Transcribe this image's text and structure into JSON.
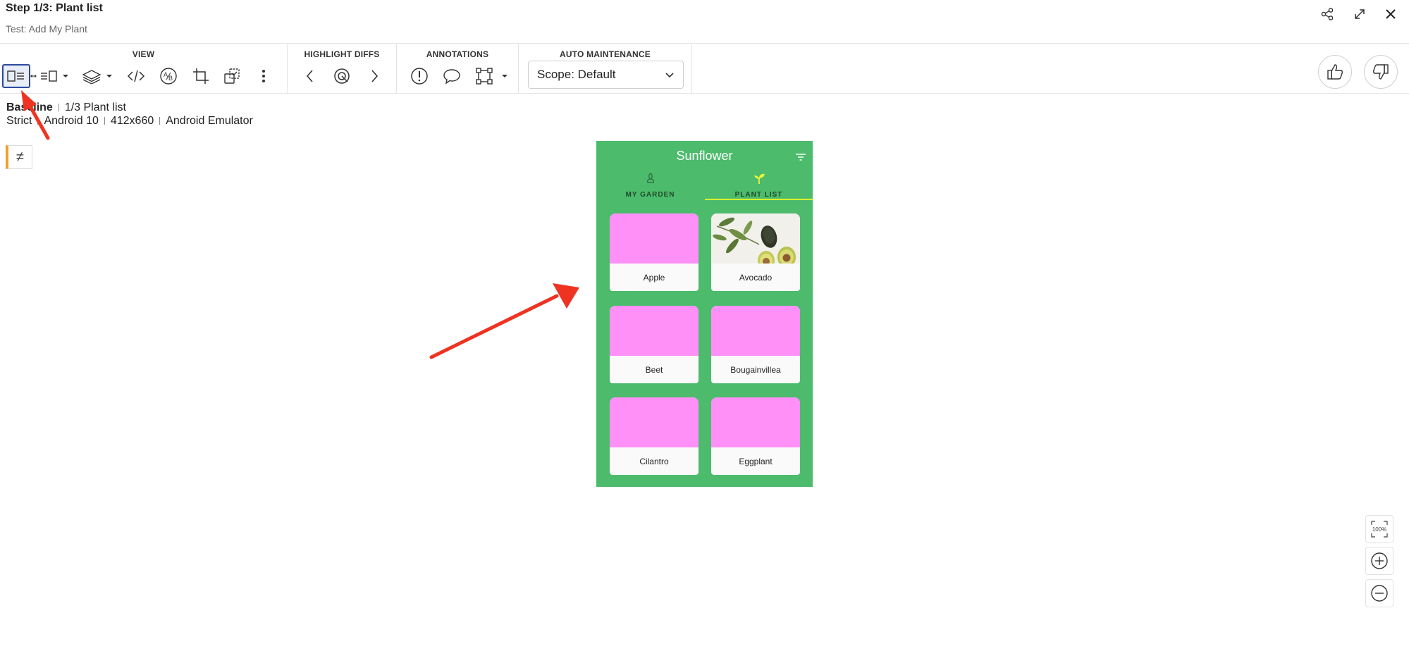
{
  "header": {
    "title": "Step 1/3: Plant list",
    "subtitle": "Test: Add My Plant",
    "icons": [
      "share-icon",
      "expand-icon",
      "close-icon"
    ]
  },
  "toolbar": {
    "view_label": "VIEW",
    "highlight_label": "HIGHLIGHT DIFFS",
    "annotations_label": "ANNOTATIONS",
    "auto_maintenance_label": "AUTO MAINTENANCE",
    "scope_value": "Scope: Default"
  },
  "info": {
    "baseline": "Baseline",
    "baseline_step": "1/3 Plant list",
    "match_level": "Strict",
    "os": "Android 10",
    "size": "412x660",
    "device": "Android Emulator"
  },
  "diff_badge": "≠",
  "app": {
    "title": "Sunflower",
    "tabs": [
      {
        "label": "MY GARDEN",
        "active": false
      },
      {
        "label": "PLANT LIST",
        "active": true
      }
    ],
    "plants": [
      {
        "name": "Apple",
        "image": "placeholder"
      },
      {
        "name": "Avocado",
        "image": "photo"
      },
      {
        "name": "Beet",
        "image": "placeholder"
      },
      {
        "name": "Bougainvillea",
        "image": "placeholder"
      },
      {
        "name": "Cilantro",
        "image": "placeholder"
      },
      {
        "name": "Eggplant",
        "image": "placeholder"
      }
    ],
    "colors": {
      "background": "#4cbb6c",
      "placeholder": "#ff90f8",
      "tab_indicator": "#d6ef2e"
    }
  },
  "zoom": {
    "fit_label": "100%"
  },
  "colors": {
    "annotation_arrow": "#ee3322",
    "active_border": "#2b4b9b"
  }
}
